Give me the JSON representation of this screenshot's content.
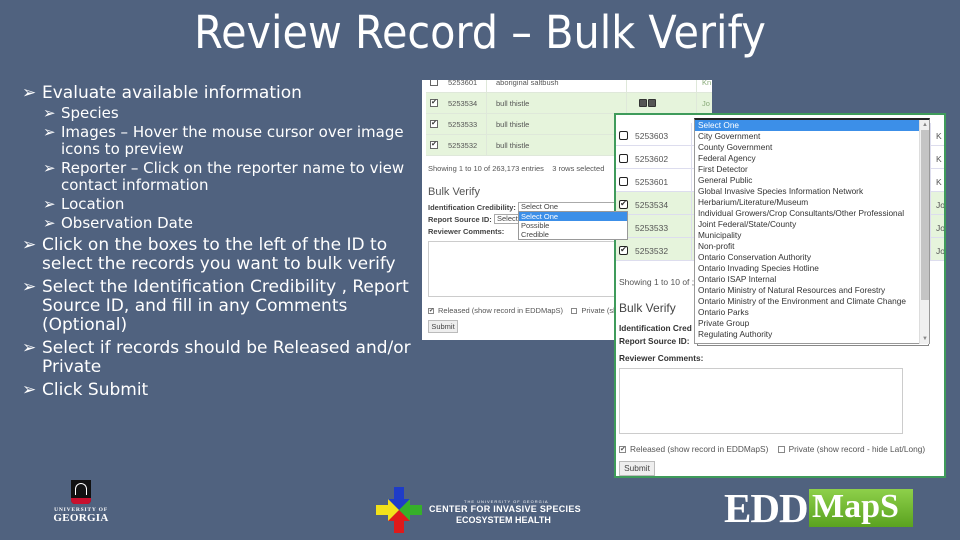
{
  "slide": {
    "title": "Review Record – Bulk Verify",
    "bullets": [
      {
        "level": 1,
        "text": "Evaluate available information"
      },
      {
        "level": 2,
        "text": "Species"
      },
      {
        "level": 2,
        "text": "Images – Hover the mouse cursor over image icons to preview"
      },
      {
        "level": 2,
        "text": "Reporter – Click on the reporter name to view contact information"
      },
      {
        "level": 2,
        "text": "Location"
      },
      {
        "level": 2,
        "text": "Observation Date"
      },
      {
        "level": 1,
        "text": "Click on the boxes to the left of the ID to select the records you want to bulk verify"
      },
      {
        "level": 1,
        "text": "Select the Identification Credibility , Report Source ID, and fill in any Comments (Optional)"
      },
      {
        "level": 1,
        "text": "Select if records should be Released and/or Private"
      },
      {
        "level": 1,
        "text": "Click Submit"
      }
    ],
    "bullet_glyph": "➢"
  },
  "screenshot1": {
    "rows": [
      {
        "checked": false,
        "id": "5253601",
        "species": "aboriginal saltbush",
        "reporter": "Kn"
      },
      {
        "checked": true,
        "id": "5253534",
        "species": "bull thistle",
        "has_images": true,
        "reporter": "Jo"
      },
      {
        "checked": true,
        "id": "5253533",
        "species": "bull thistle",
        "reporter": ""
      },
      {
        "checked": true,
        "id": "5253532",
        "species": "bull thistle",
        "reporter": ""
      }
    ],
    "info": "Showing 1 to 10 of 263,173 entries    3 rows selected",
    "bulk_verify_heading": "Bulk Verify",
    "labels": {
      "identification_credibility": "Identification Credibility:",
      "report_source_id": "Report Source ID:",
      "reviewer_comments": "Reviewer Comments:"
    },
    "credibility_value": "Select One",
    "report_source_value": "Select",
    "credibility_options": [
      "Select One",
      "Possible",
      "Credible"
    ],
    "credibility_highlighted": "Select One",
    "released_label": "Released (show record in EDDMapS)",
    "released_checked": true,
    "private_label": "Private (sh",
    "private_checked": false,
    "submit_label": "Submit"
  },
  "screenshot2": {
    "rows": [
      {
        "checked": false,
        "id": "5253603",
        "reporter": "K"
      },
      {
        "checked": false,
        "id": "5253602",
        "reporter": "K"
      },
      {
        "checked": false,
        "id": "5253601",
        "reporter": "K"
      },
      {
        "checked": true,
        "id": "5253534",
        "reporter": "Jo"
      },
      {
        "checked": true,
        "id": "5253533",
        "reporter": "Jo"
      },
      {
        "checked": true,
        "id": "5253532",
        "reporter": "Jo"
      }
    ],
    "info": "Showing 1 to 10 of ;",
    "bulk_verify_heading": "Bulk Verify",
    "labels": {
      "identification_credibility": "Identification Cred",
      "report_source_id": "Report Source ID:",
      "reviewer_comments": "Reviewer Comments:"
    },
    "report_source_value": "Select One",
    "report_source_options": [
      "Select One",
      "City Government",
      "County Government",
      "Federal Agency",
      "First Detector",
      "General Public",
      "Global Invasive Species Information Network",
      "Herbarium/Literature/Museum",
      "Individual Growers/Crop Consultants/Other Professional",
      "Joint Federal/State/County",
      "Municipality",
      "Non-profit",
      "Ontario Conservation Authority",
      "Ontario Invading Species Hotline",
      "Ontario ISAP Internal",
      "Ontario Ministry of Natural Resources and Forestry",
      "Ontario Ministry of the Environment and Climate Change",
      "Ontario Parks",
      "Private Group",
      "Regulating Authority"
    ],
    "report_source_highlighted": "Select One",
    "released_label": "Released (show record in EDDMapS)",
    "released_checked": true,
    "private_label": "Private (show record - hide Lat/Long)",
    "private_checked": false,
    "submit_label": "Submit"
  },
  "logos": {
    "uga_line1": "UNIVERSITY OF",
    "uga_line2": "GEORGIA",
    "cise_line1": "THE UNIVERSITY OF GEORGIA",
    "cise_line2": "CENTER FOR INVASIVE SPECIES",
    "cise_line3": "ECOSYSTEM HEALTH",
    "edd_part1": "EDD",
    "edd_part2": "MapS"
  },
  "colors": {
    "background": "#50627f",
    "selected_row": "#e6f4dc",
    "highlight": "#3c8fe8",
    "frame_green": "#3f9b5b",
    "uga_red": "#c8102e"
  }
}
